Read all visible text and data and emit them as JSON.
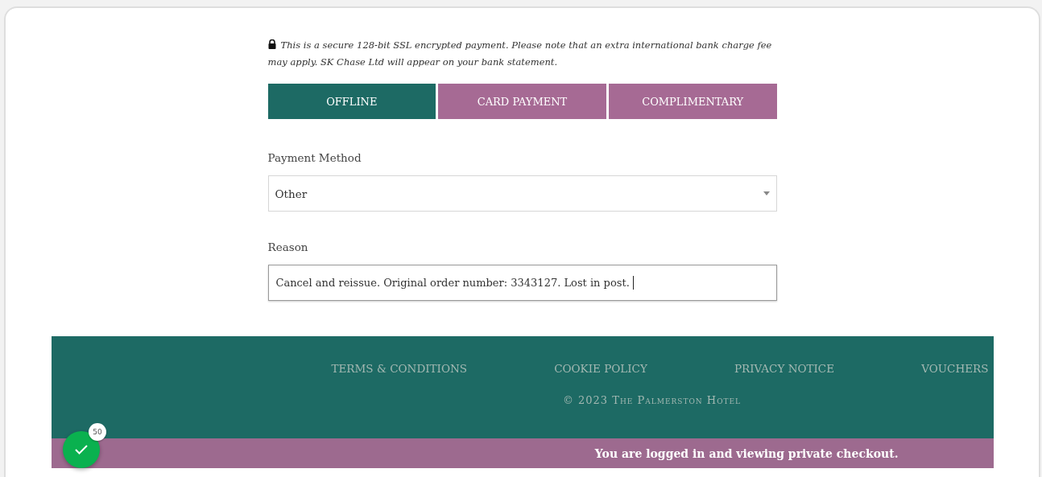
{
  "notice": "This is a secure 128-bit SSL encrypted payment. Please note that an extra international bank charge fee may apply. SK Chase Ltd will appear on your bank statement.",
  "tabs": [
    {
      "label": "OFFLINE",
      "selected": true
    },
    {
      "label": "CARD PAYMENT",
      "selected": false
    },
    {
      "label": "COMPLIMENTARY",
      "selected": false
    }
  ],
  "payment_method": {
    "label": "Payment Method",
    "value": "Other"
  },
  "reason": {
    "label": "Reason",
    "value": "Cancel and reissue. Original order number: 3343127. Lost in post."
  },
  "footer": {
    "links": [
      "TERMS & CONDITIONS",
      "COOKIE POLICY",
      "PRIVACY NOTICE",
      "VOUCHERS"
    ],
    "copyright": "© 2023 The Palmerston Hotel"
  },
  "private_bar": "You are logged in and viewing private checkout.",
  "badge": {
    "count": "50"
  }
}
